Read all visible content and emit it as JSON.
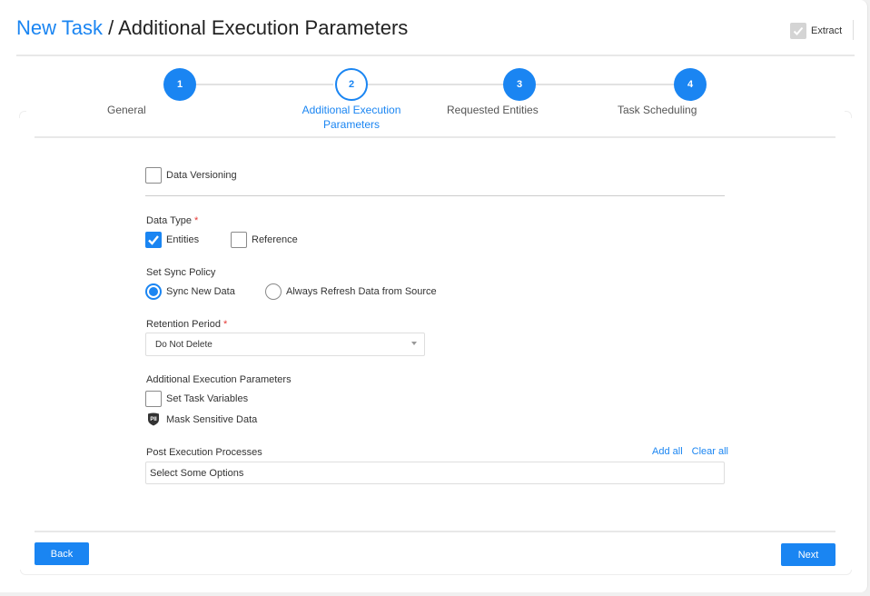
{
  "header": {
    "breadcrumb_root": "New Task",
    "separator": " / ",
    "page_title": "Additional Execution Parameters",
    "extract": {
      "label": "Extract",
      "checked": true,
      "disabled": true
    }
  },
  "stepper": {
    "current_step": 2,
    "steps": [
      {
        "number": "1",
        "label": "General",
        "state": "completed"
      },
      {
        "number": "2",
        "label": "Additional Execution Parameters",
        "state": "current"
      },
      {
        "number": "3",
        "label": "Requested Entities",
        "state": "upcoming"
      },
      {
        "number": "4",
        "label": "Task Scheduling",
        "state": "upcoming"
      }
    ]
  },
  "form": {
    "data_versioning": {
      "label": "Data Versioning",
      "checked": false
    },
    "data_type": {
      "label": "Data Type",
      "required_mark": "*",
      "options": [
        {
          "label": "Entities",
          "checked": true
        },
        {
          "label": "Reference",
          "checked": false
        }
      ]
    },
    "sync_policy": {
      "label": "Set Sync Policy",
      "options": [
        {
          "label": "Sync New Data",
          "selected": true
        },
        {
          "label": "Always Refresh Data from Source",
          "selected": false
        }
      ]
    },
    "retention_period": {
      "label": "Retention Period",
      "required_mark": "*",
      "value": "Do Not Delete"
    },
    "additional_params": {
      "label": "Additional Execution Parameters",
      "set_task_variables": {
        "label": "Set Task Variables",
        "checked": false
      },
      "mask_sensitive_data": {
        "label": "Mask Sensitive Data",
        "icon": "pii-shield-icon",
        "icon_text": "PII"
      }
    },
    "post_execution": {
      "label": "Post Execution Processes",
      "add_all": "Add all",
      "clear_all": "Clear all",
      "placeholder": "Select Some Options"
    }
  },
  "footer": {
    "back_label": "Back",
    "next_label": "Next"
  },
  "colors": {
    "accent": "#1a85f2",
    "required": "#e53935",
    "disabled_checkbox": "#d4d4d4"
  }
}
